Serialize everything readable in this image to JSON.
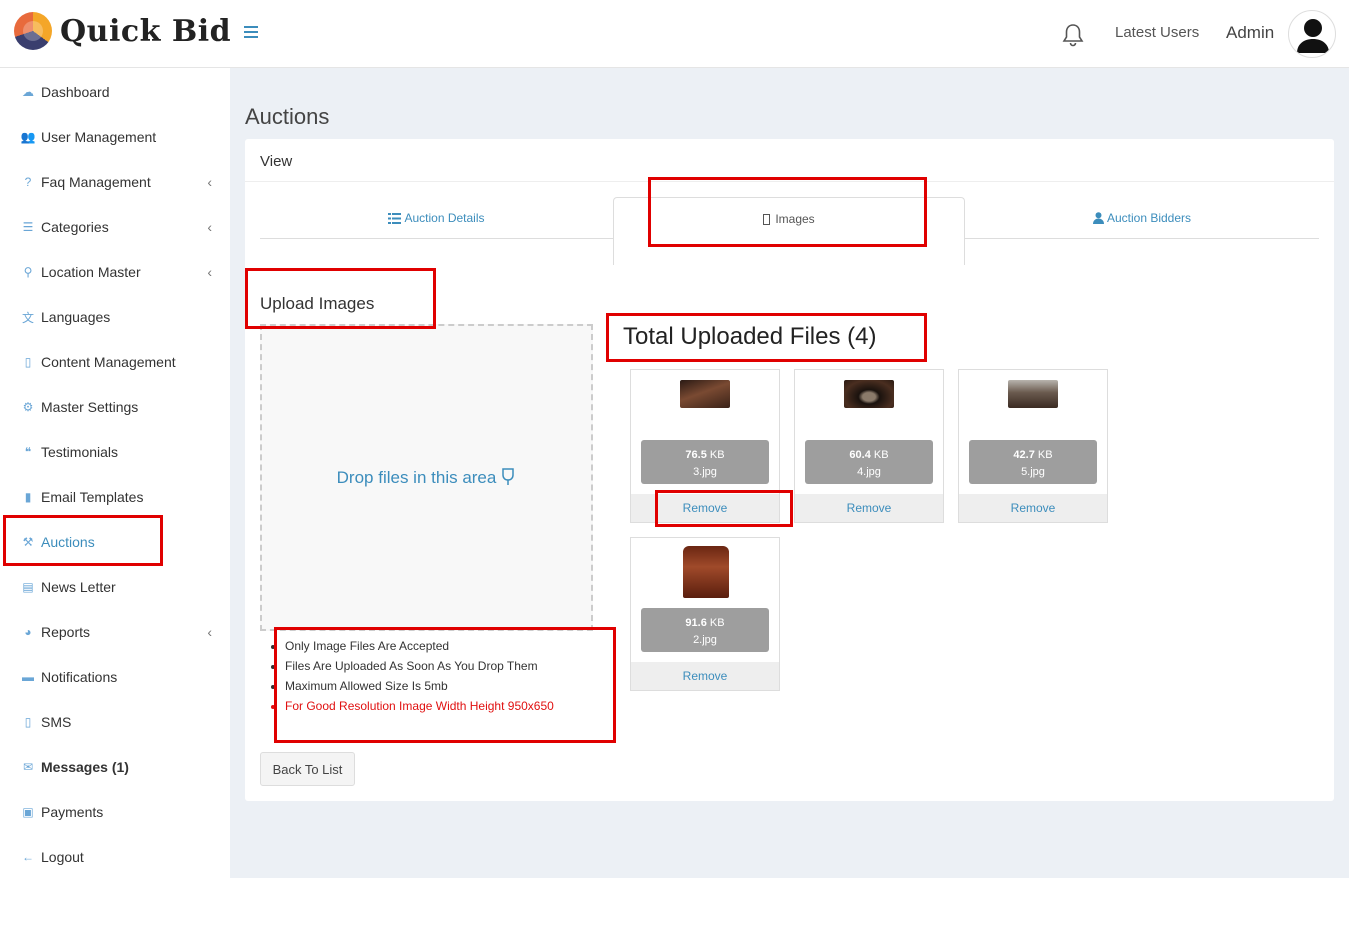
{
  "brand": {
    "name": "Quick Bid"
  },
  "topbar": {
    "latest_users": "Latest Users",
    "admin": "Admin"
  },
  "sidebar": {
    "items": [
      {
        "label": "Dashboard",
        "icon": "cloud-icon"
      },
      {
        "label": "User Management",
        "icon": "users-icon"
      },
      {
        "label": "Faq Management",
        "icon": "question-icon",
        "has_sub": true
      },
      {
        "label": "Categories",
        "icon": "list-icon",
        "has_sub": true
      },
      {
        "label": "Location Master",
        "icon": "pin-icon",
        "has_sub": true
      },
      {
        "label": "Languages",
        "icon": "language-icon"
      },
      {
        "label": "Content Management",
        "icon": "file-icon"
      },
      {
        "label": "Master Settings",
        "icon": "cogs-icon"
      },
      {
        "label": "Testimonials",
        "icon": "quote-icon"
      },
      {
        "label": "Email Templates",
        "icon": "book-icon"
      },
      {
        "label": "Auctions",
        "icon": "gavel-icon",
        "active": true
      },
      {
        "label": "News Letter",
        "icon": "newspaper-icon"
      },
      {
        "label": "Reports",
        "icon": "pie-chart-icon",
        "has_sub": true
      },
      {
        "label": "Notifications",
        "icon": "briefcase-icon"
      },
      {
        "label": "SMS",
        "icon": "mobile-icon"
      },
      {
        "label": "Messages (1)",
        "icon": "envelope-icon",
        "bold": true
      },
      {
        "label": "Payments",
        "icon": "money-icon"
      },
      {
        "label": "Logout",
        "icon": "arrow-left-icon"
      }
    ]
  },
  "page": {
    "title": "Auctions",
    "box_title": "View"
  },
  "tabs": [
    {
      "label": "Auction Details",
      "icon": "list-icon"
    },
    {
      "label": "Images",
      "icon": "image-icon",
      "active": true
    },
    {
      "label": "Auction Bidders",
      "icon": "user-icon"
    }
  ],
  "upload": {
    "title": "Upload Images",
    "drop_text": "Drop files in this area",
    "rules": [
      "Only Image Files Are Accepted",
      "Files Are Uploaded As Soon As You Drop Them",
      "Maximum Allowed Size Is 5mb",
      "For Good Resolution Image Width Height 950x650"
    ],
    "back_button": "Back To List"
  },
  "files": {
    "title": "Total Uploaded Files (4)",
    "remove_label": "Remove",
    "items": [
      {
        "size": "76.5",
        "unit": "KB",
        "name": "3.jpg",
        "color": "#5a3a2a"
      },
      {
        "size": "60.4",
        "unit": "KB",
        "name": "4.jpg",
        "color": "#3a2a22"
      },
      {
        "size": "42.7",
        "unit": "KB",
        "name": "5.jpg",
        "color": "#4a3a30"
      },
      {
        "size": "91.6",
        "unit": "KB",
        "name": "2.jpg",
        "color": "#8a3a22"
      }
    ]
  },
  "colors": {
    "accent": "#3c8dbc",
    "annotation": "#e00000",
    "warning_text": "#e01010"
  }
}
